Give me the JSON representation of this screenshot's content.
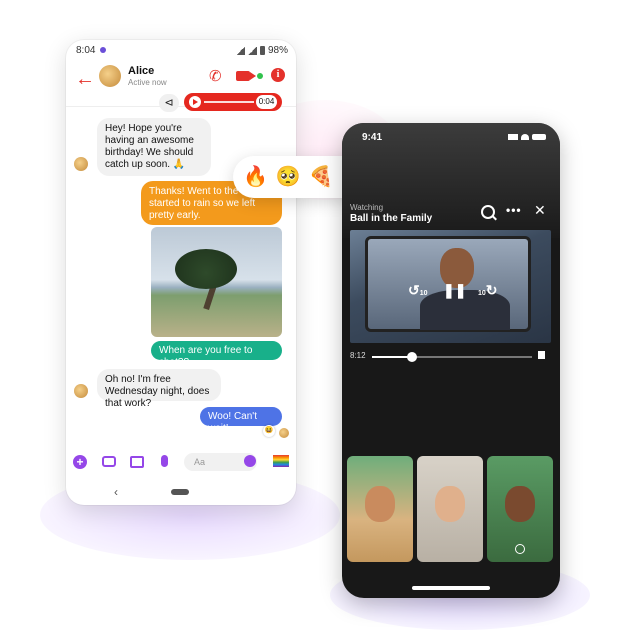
{
  "android": {
    "status_time": "8:04",
    "battery": "98%",
    "contact_name": "Alice",
    "contact_status": "Active now",
    "voice_duration": "0:04",
    "messages": {
      "m1": "Hey! Hope you're having an awesome birthday! We should catch up soon. 🙏",
      "m2": "Thanks! Went to the ... it started to rain so we left pretty early.",
      "m3": "When are you free to chat??",
      "m4": "Oh no! I'm free Wednesday night, does that work?",
      "m5": "Woo! Can't wait!"
    },
    "composer_placeholder": "Aa"
  },
  "reactions": [
    "🔥",
    "🥺",
    "🍕",
    "🦄",
    "🎉",
    "💯"
  ],
  "iphone": {
    "status_time": "9:41",
    "watching_label": "Watching",
    "show_title": "Ball in the Family",
    "elapsed": "8:12",
    "playback_progress": 0.25,
    "skip_back": "10",
    "skip_forward": "10"
  },
  "colors": {
    "messenger_red": "#e4312b",
    "orange_bubble": "#f39a1c",
    "green_bubble": "#18b08a",
    "blue_bubble": "#4e73e6",
    "composer_purple": "#9547e8"
  }
}
